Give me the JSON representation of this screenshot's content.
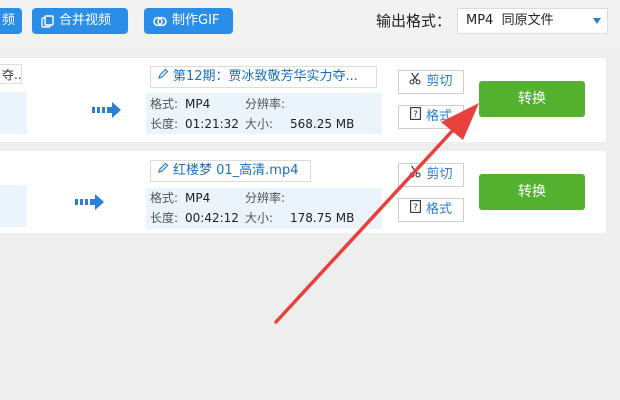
{
  "toolbar": {
    "partial_label": "频",
    "merge_label": "合并视频",
    "gif_label": "制作GIF",
    "output_label": "输出格式：",
    "output_value": "MP4  同原文件"
  },
  "files": [
    {
      "source_partial": "夺...",
      "name": "第12期：贾冰致敬芳华实力夺...",
      "format_label": "格式:",
      "format": "MP4",
      "resolution_label": "分辨率:",
      "resolution": "",
      "duration_label": "长度:",
      "duration": "01:21:32",
      "size_label": "大小:",
      "size": "568.25 MB",
      "cut_label": "剪切",
      "format_btn_label": "格式",
      "convert_label": "转换"
    },
    {
      "source_partial": "",
      "name": "红楼梦 01_高清.mp4",
      "format_label": "格式:",
      "format": "MP4",
      "resolution_label": "分辨率:",
      "resolution": "",
      "duration_label": "长度:",
      "duration": "00:42:12",
      "size_label": "大小:",
      "size": "178.75 MB",
      "cut_label": "剪切",
      "format_btn_label": "格式",
      "convert_label": "转换"
    }
  ],
  "colors": {
    "toolbar_button": "#2a8ee8",
    "convert_button": "#54b02f",
    "annotation_arrow": "#e8403c",
    "accent_blue": "#1a6fc4"
  }
}
